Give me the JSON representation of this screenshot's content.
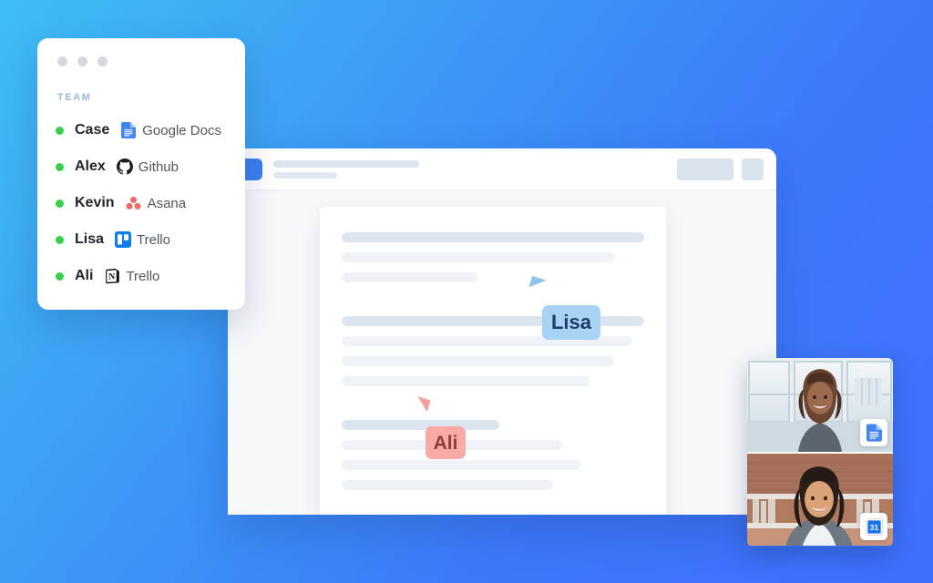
{
  "background": {
    "gradient_from": "#3fbdf4",
    "gradient_to": "#3e6ffc"
  },
  "team_panel": {
    "window_dots": [
      "#d6d8dc",
      "#d6d8dc",
      "#d6d8dc"
    ],
    "section_label": "TEAM",
    "label_color": "#9fb6e3",
    "status_color": "#38d04a",
    "members": [
      {
        "name": "Case",
        "app": "Google Docs",
        "icon": "google-docs-icon",
        "status": "online"
      },
      {
        "name": "Alex",
        "app": "Github",
        "icon": "github-icon",
        "status": "online"
      },
      {
        "name": "Kevin",
        "app": "Asana",
        "icon": "asana-icon",
        "status": "online"
      },
      {
        "name": "Lisa",
        "app": "Trello",
        "icon": "trello-icon",
        "status": "online"
      },
      {
        "name": "Ali",
        "app": "Trello",
        "icon": "notion-icon",
        "status": "online"
      }
    ]
  },
  "app_window": {
    "logo_color": "#3d7ef0",
    "header_placeholders": [
      "title-bar",
      "subtitle-bar"
    ],
    "header_actions": [
      "action-block-large",
      "action-block-small"
    ],
    "document": {
      "paragraphs": [
        {
          "lines": [
            {
              "width": "100%",
              "tone": "dark"
            },
            {
              "width": "90%",
              "tone": "light"
            },
            {
              "width": "45%",
              "tone": "light"
            }
          ]
        },
        {
          "lines": [
            {
              "width": "100%",
              "tone": "dark"
            },
            {
              "width": "96%",
              "tone": "light"
            },
            {
              "width": "90%",
              "tone": "light"
            },
            {
              "width": "82%",
              "tone": "light"
            }
          ]
        },
        {
          "lines": [
            {
              "width": "52%",
              "tone": "dark"
            },
            {
              "width": "73%",
              "tone": "light"
            },
            {
              "width": "79%",
              "tone": "light"
            },
            {
              "width": "70%",
              "tone": "light"
            }
          ]
        }
      ]
    }
  },
  "collaborators": [
    {
      "name": "Lisa",
      "tag_bg": "#a9d3f5",
      "tag_fg": "#1c3f66",
      "cursor_color": "#90c2ef"
    },
    {
      "name": "Ali",
      "tag_bg": "#f9aaa6",
      "tag_fg": "#8e3a38",
      "cursor_color": "#f3a09c"
    }
  ],
  "video_call": {
    "tiles": [
      {
        "participant": "video-participant-1",
        "badge_icon": "google-docs-icon",
        "badge_label": ""
      },
      {
        "participant": "video-participant-2",
        "badge_icon": "google-calendar-icon",
        "badge_label": "31"
      }
    ]
  }
}
